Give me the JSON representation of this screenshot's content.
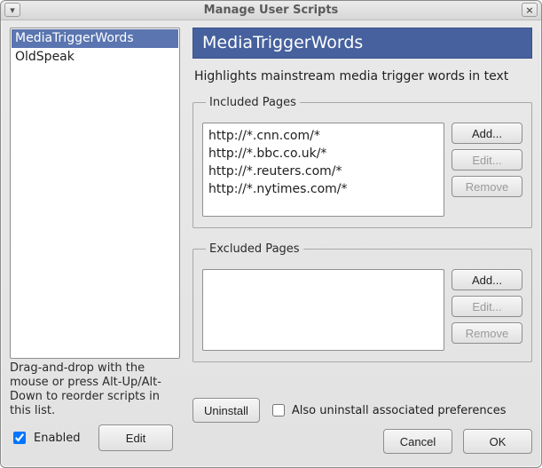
{
  "window": {
    "title": "Manage User Scripts",
    "minimize_glyph": "▾",
    "close_glyph": "×"
  },
  "left": {
    "scripts": [
      {
        "name": "MediaTriggerWords",
        "selected": true
      },
      {
        "name": "OldSpeak",
        "selected": false
      }
    ],
    "hint": "Drag-and-drop with the mouse or press Alt-Up/Alt-Down to reorder scripts in this list.",
    "enabled_label": "Enabled",
    "enabled_checked": true,
    "edit_label": "Edit"
  },
  "script": {
    "title": "MediaTriggerWords",
    "description": "Highlights mainstream media trigger words in text"
  },
  "included": {
    "legend": "Included Pages",
    "items": [
      "http://*.cnn.com/*",
      "http://*.bbc.co.uk/*",
      "http://*.reuters.com/*",
      "http://*.nytimes.com/*"
    ],
    "add_label": "Add...",
    "edit_label": "Edit...",
    "remove_label": "Remove"
  },
  "excluded": {
    "legend": "Excluded Pages",
    "items": [],
    "add_label": "Add...",
    "edit_label": "Edit...",
    "remove_label": "Remove"
  },
  "bottom": {
    "uninstall_label": "Uninstall",
    "also_uninstall_label": "Also uninstall associated preferences",
    "also_uninstall_checked": false,
    "cancel_label": "Cancel",
    "ok_label": "OK"
  }
}
